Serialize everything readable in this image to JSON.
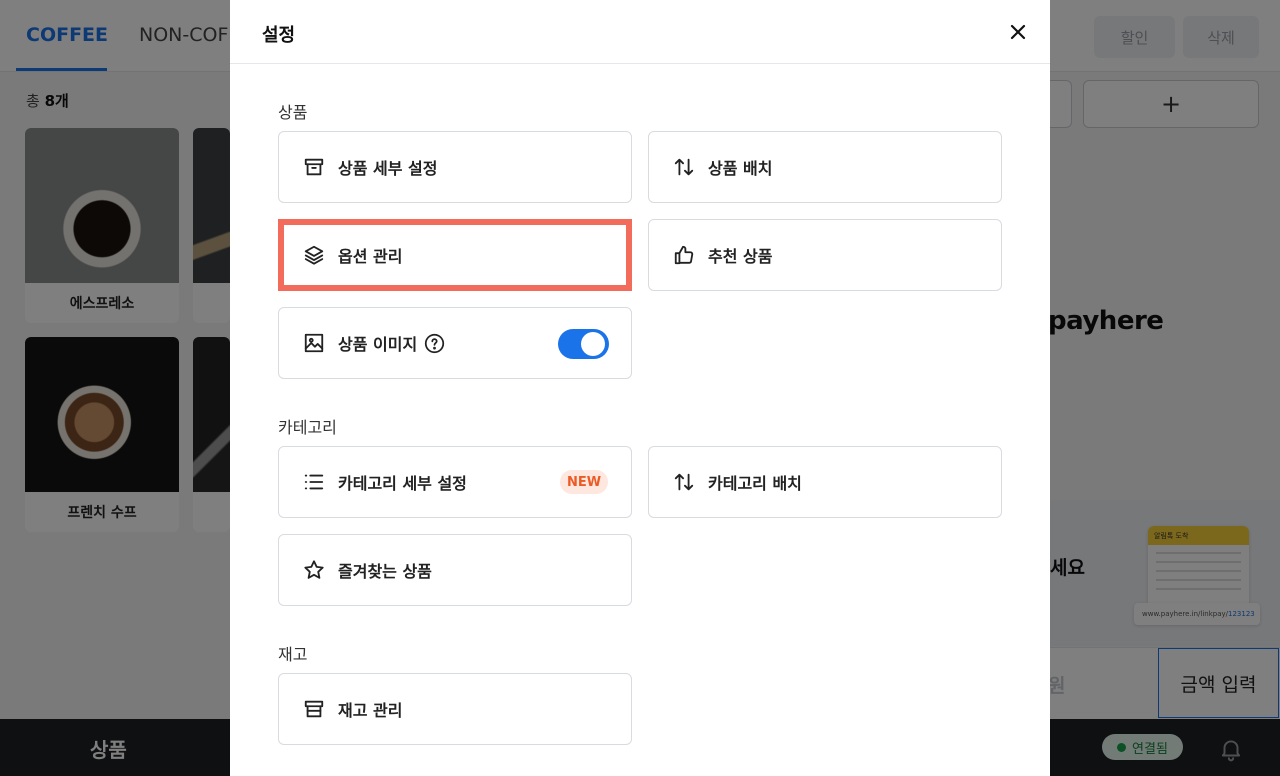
{
  "background": {
    "tabs": [
      {
        "label": "COFFEE",
        "active": true
      },
      {
        "label": "NON-COF",
        "active": false
      }
    ],
    "top_buttons": {
      "discount": "할인",
      "delete": "삭제"
    },
    "count": {
      "prefix": "총 ",
      "value": "8개"
    },
    "products": [
      {
        "name": "에스프레소"
      },
      {
        "name": "프렌치 수프"
      }
    ],
    "add_button_label": "+",
    "logo_text": "payhere",
    "promo": {
      "text": "세요",
      "card_title": "알림톡 도착",
      "url_prefix": "www.payhere.in/linkpay/",
      "url_code": "123123"
    },
    "amount_won": "원",
    "amount_input_label": "금액 입력",
    "bottom_bar": {
      "label": "상품",
      "status": "연결됨"
    },
    "accent": "#1a73e8"
  },
  "modal": {
    "title": "설정",
    "sections": {
      "product": {
        "label": "상품",
        "items": {
          "detail": "상품 세부 설정",
          "arrange": "상품 배치",
          "options": "옵션 관리",
          "recommended": "추천 상품",
          "image": "상품 이미지"
        },
        "image_toggle_on": true
      },
      "category": {
        "label": "카테고리",
        "items": {
          "detail": "카테고리 세부 설정",
          "detail_badge": "NEW",
          "arrange": "카테고리 배치",
          "favorites": "즐겨찾는 상품"
        }
      },
      "stock": {
        "label": "재고",
        "items": {
          "manage": "재고 관리"
        }
      }
    },
    "highlight_color": "#f26b5b"
  }
}
